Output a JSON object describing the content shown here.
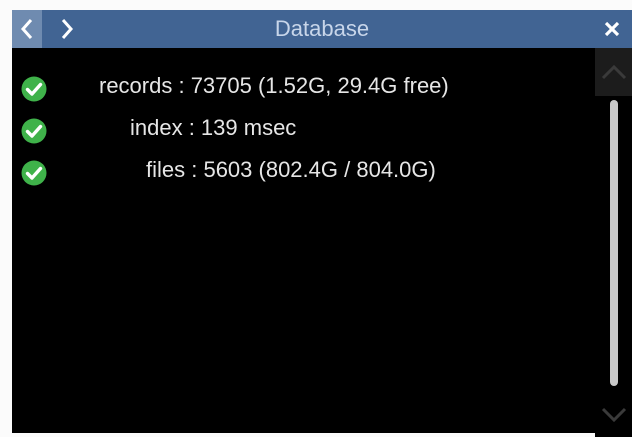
{
  "window": {
    "title": "Database"
  },
  "titlebar": {
    "back_icon": "chevron-left-icon",
    "forward_icon": "chevron-right-icon",
    "close_icon": "close-icon",
    "colors": {
      "titlebar_bg": "#416493",
      "back_button_bg": "#6f8bb0",
      "title_text": "#c8d6ea"
    }
  },
  "status_rows": [
    {
      "icon": "check-circle-icon",
      "text": "records : 73705 (1.52G, 29.4G free)"
    },
    {
      "icon": "check-circle-icon",
      "text": "index : 139 msec"
    },
    {
      "icon": "check-circle-icon",
      "text": "files : 5603 (802.4G / 804.0G)"
    }
  ],
  "scrollbar": {
    "up_icon": "chevron-up-icon",
    "down_icon": "chevron-down-icon"
  },
  "colors": {
    "content_bg": "#000000",
    "text": "#e6e6e6",
    "ok_icon": "#3fb24a"
  }
}
